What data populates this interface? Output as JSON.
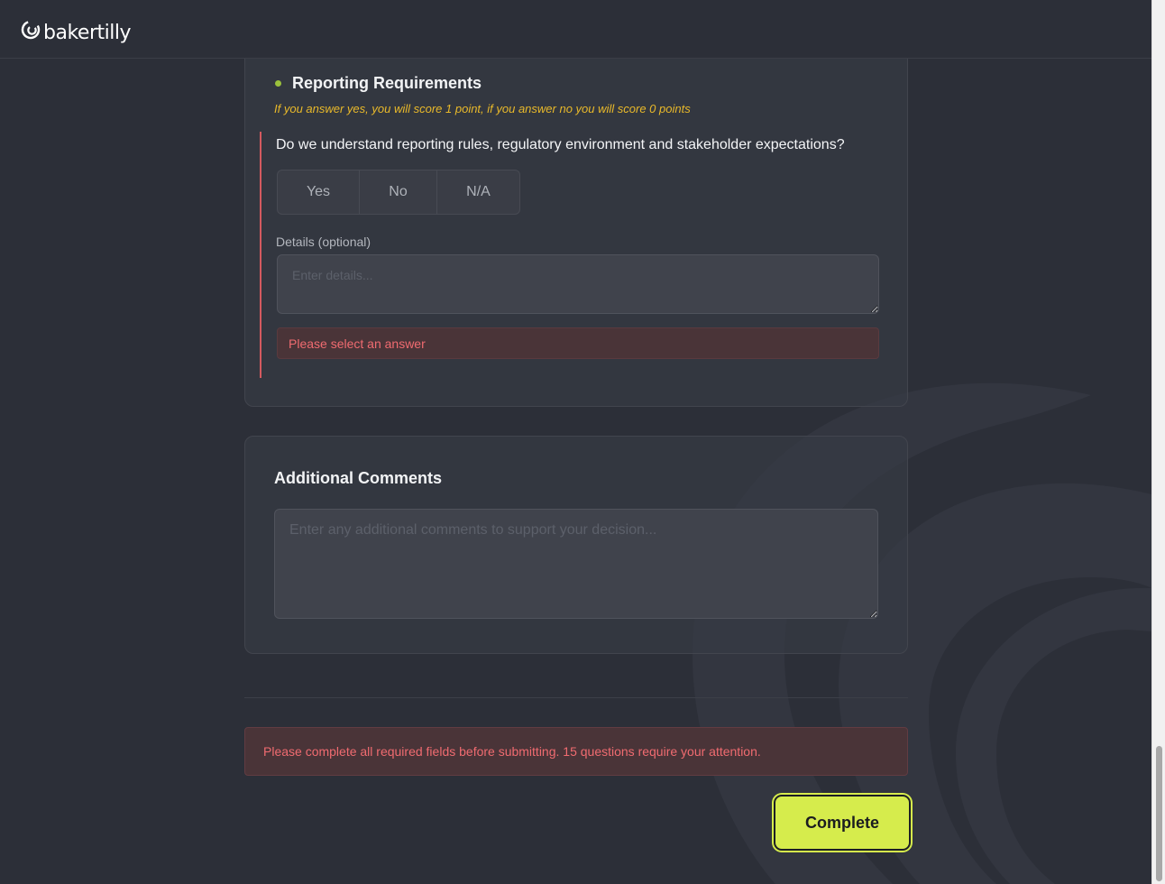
{
  "header": {
    "brand": "bakertilly",
    "logo_icon": "bakertilly-swirl-logo"
  },
  "section": {
    "title": "Reporting Requirements",
    "scoring_note": "If you answer yes, you will score 1 point, if you answer no you will score 0 points",
    "question": "Do we understand reporting rules, regulatory environment and stakeholder expectations?",
    "answers": [
      "Yes",
      "No",
      "N/A"
    ],
    "details_label": "Details (optional)",
    "details_placeholder": "Enter details...",
    "error": "Please select an answer"
  },
  "comments": {
    "title": "Additional Comments",
    "placeholder": "Enter any additional comments to support your decision..."
  },
  "footer": {
    "error_banner": "Please complete all required fields before submitting. 15 questions require your attention.",
    "complete_label": "Complete"
  },
  "colors": {
    "background": "#2c2f38",
    "accent": "#d6ec4c",
    "error": "#f06b70",
    "warning": "#e9b92a",
    "bullet": "#9bc13c"
  }
}
